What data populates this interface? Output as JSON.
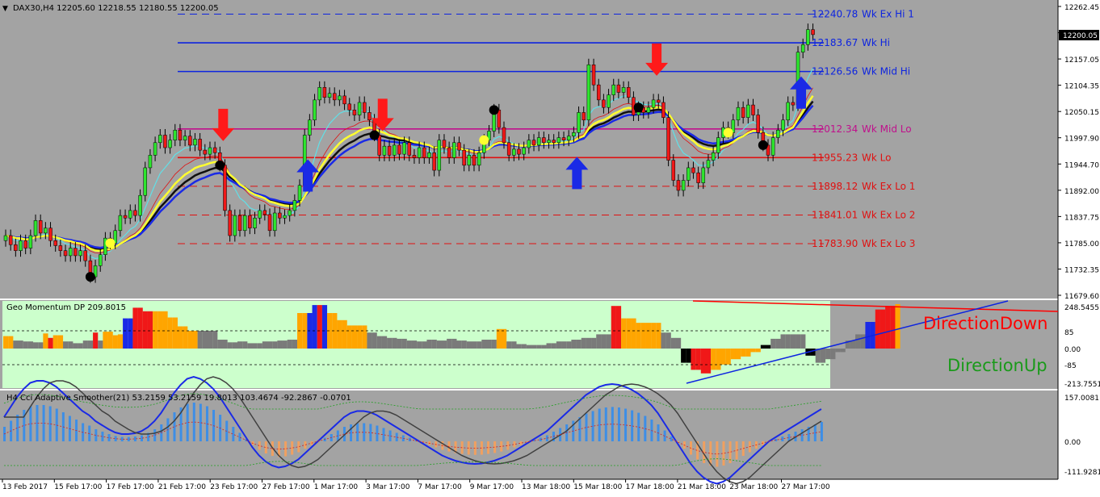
{
  "window": {
    "symbol_info": "DAX30,H4  12205.60 12218.55 12180.55 12200.05",
    "current_price_label": "12200.05"
  },
  "colors": {
    "background": "#a3a3a3",
    "bull_candle": "#2ee62e",
    "bear_candle": "#f01818",
    "resistance_line": "#0d24e0",
    "support_line": "#e01010",
    "mid_lo_line": "#c0108c",
    "ma_yellow": "#ffff30",
    "ma_blue": "#1a2ae6",
    "ma_black": "#101010",
    "ma_cyan": "#60e0e8",
    "momentum_bg": "#ccffcc",
    "hist_orange": "#ffa500",
    "hist_gray": "#7a7a7a",
    "cci_bar": "#3d8ee6",
    "cci_bar_neg": "#f0a060"
  },
  "time_axis": [
    "13 Feb 2017",
    "15 Feb 17:00",
    "17 Feb 17:00",
    "21 Feb 17:00",
    "23 Feb 17:00",
    "27 Feb 17:00",
    "1 Mar 17:00",
    "3 Mar 17:00",
    "7 Mar 17:00",
    "9 Mar 17:00",
    "13 Mar 18:00",
    "15 Mar 18:00",
    "17 Mar 18:00",
    "21 Mar 18:00",
    "23 Mar 18:00",
    "27 Mar 17:00"
  ],
  "main_price_axis": [
    "12262.45",
    "12208.75",
    "12157.05",
    "12104.35",
    "12050.15",
    "11997.90",
    "11944.70",
    "11892.00",
    "11837.75",
    "11785.00",
    "11732.35",
    "11679.60"
  ],
  "momentum_axis": [
    "248.5455",
    "85",
    "0.00",
    "-85",
    "-213.7551"
  ],
  "cci_axis": [
    "157.0081",
    "0.00",
    "-111.9281"
  ],
  "levels": [
    {
      "name": "Wk Ex Hi 1",
      "value": "12240.78",
      "text": "Wk Ex Hi 1",
      "color": "#0d24e0",
      "style": "dashed"
    },
    {
      "name": "Wk Hi",
      "value": "12183.67",
      "text": "Wk Hi",
      "color": "#0d24e0",
      "style": "solid"
    },
    {
      "name": "Wk Mid Hi",
      "value": "12126.56",
      "text": "Wk Mid Hi",
      "color": "#0d24e0",
      "style": "solid"
    },
    {
      "name": "Wk Mid Lo",
      "value": "12012.34",
      "text": "Wk Mid Lo",
      "color": "#c0108c",
      "style": "solid"
    },
    {
      "name": "Wk Lo",
      "value": "11955.23",
      "text": "Wk Lo",
      "color": "#e01010",
      "style": "solid"
    },
    {
      "name": "Wk Ex Lo 1",
      "value": "11898.12",
      "text": "Wk Ex Lo 1",
      "color": "#e01010",
      "style": "dashed"
    },
    {
      "name": "Wk Ex Lo 2",
      "value": "11841.01",
      "text": "Wk Ex Lo 2",
      "color": "#e01010",
      "style": "dashed"
    },
    {
      "name": "Wk Ex Lo 3",
      "value": "11783.90",
      "text": "Wk Ex Lo 3",
      "color": "#e01010",
      "style": "dashed"
    }
  ],
  "momentum": {
    "title": "Geo Momentum DP  209.8015",
    "direction_down": "DirectionDown",
    "direction_up": "DirectionUp"
  },
  "cci": {
    "title": "H4 Cci Adaptive Smoother(21) 53.2159 53.2159 19.8013 103.4674 -92.2867 -0.0701"
  },
  "chart_data": {
    "type": "candlestick",
    "y_range": [
      11679.6,
      12262.45
    ],
    "levels": [
      12240.78,
      12183.67,
      12126.56,
      12012.34,
      11955.23,
      11898.12,
      11841.01,
      11783.9
    ],
    "sell_arrows_at_candle": [
      43,
      75,
      130
    ],
    "buy_arrows_at_candle": [
      60,
      114,
      159
    ],
    "candles": [
      {
        "o": 11790,
        "c": 11800
      },
      {
        "o": 11800,
        "c": 11782
      },
      {
        "o": 11782,
        "c": 11770
      },
      {
        "o": 11770,
        "c": 11790
      },
      {
        "o": 11790,
        "c": 11775
      },
      {
        "o": 11775,
        "c": 11800
      },
      {
        "o": 11800,
        "c": 11830
      },
      {
        "o": 11830,
        "c": 11805
      },
      {
        "o": 11805,
        "c": 11815
      },
      {
        "o": 11815,
        "c": 11790
      },
      {
        "o": 11790,
        "c": 11780
      },
      {
        "o": 11780,
        "c": 11770
      },
      {
        "o": 11770,
        "c": 11760
      },
      {
        "o": 11760,
        "c": 11775
      },
      {
        "o": 11775,
        "c": 11760
      },
      {
        "o": 11760,
        "c": 11770
      },
      {
        "o": 11770,
        "c": 11750
      },
      {
        "o": 11750,
        "c": 11718
      },
      {
        "o": 11718,
        "c": 11740
      },
      {
        "o": 11740,
        "c": 11762
      },
      {
        "o": 11762,
        "c": 11795
      },
      {
        "o": 11795,
        "c": 11785
      },
      {
        "o": 11785,
        "c": 11810
      },
      {
        "o": 11810,
        "c": 11840
      },
      {
        "o": 11840,
        "c": 11835
      },
      {
        "o": 11835,
        "c": 11850
      },
      {
        "o": 11850,
        "c": 11840
      },
      {
        "o": 11840,
        "c": 11880
      },
      {
        "o": 11880,
        "c": 11935
      },
      {
        "o": 11935,
        "c": 11960
      },
      {
        "o": 11960,
        "c": 11985
      },
      {
        "o": 11985,
        "c": 12000
      },
      {
        "o": 12000,
        "c": 11975
      },
      {
        "o": 11975,
        "c": 11990
      },
      {
        "o": 11990,
        "c": 12010
      },
      {
        "o": 12010,
        "c": 11990
      },
      {
        "o": 11990,
        "c": 11998
      },
      {
        "o": 11998,
        "c": 11980
      },
      {
        "o": 11980,
        "c": 11992
      },
      {
        "o": 11992,
        "c": 11970
      },
      {
        "o": 11970,
        "c": 11962
      },
      {
        "o": 11962,
        "c": 11975
      },
      {
        "o": 11975,
        "c": 11965
      },
      {
        "o": 11965,
        "c": 11940
      },
      {
        "o": 11940,
        "c": 11850
      },
      {
        "o": 11850,
        "c": 11800
      },
      {
        "o": 11800,
        "c": 11840
      },
      {
        "o": 11840,
        "c": 11810
      },
      {
        "o": 11810,
        "c": 11840
      },
      {
        "o": 11840,
        "c": 11815
      },
      {
        "o": 11815,
        "c": 11835
      },
      {
        "o": 11835,
        "c": 11850
      },
      {
        "o": 11850,
        "c": 11842
      },
      {
        "o": 11842,
        "c": 11810
      },
      {
        "o": 11810,
        "c": 11845
      },
      {
        "o": 11845,
        "c": 11835
      },
      {
        "o": 11835,
        "c": 11840
      },
      {
        "o": 11840,
        "c": 11850
      },
      {
        "o": 11850,
        "c": 11870
      },
      {
        "o": 11870,
        "c": 11900
      },
      {
        "o": 11900,
        "c": 12000
      },
      {
        "o": 12000,
        "c": 12030
      },
      {
        "o": 12030,
        "c": 12070
      },
      {
        "o": 12070,
        "c": 12095
      },
      {
        "o": 12095,
        "c": 12075
      },
      {
        "o": 12075,
        "c": 12083
      },
      {
        "o": 12083,
        "c": 12070
      },
      {
        "o": 12070,
        "c": 12078
      },
      {
        "o": 12078,
        "c": 12062
      },
      {
        "o": 12062,
        "c": 12050
      },
      {
        "o": 12050,
        "c": 12040
      },
      {
        "o": 12040,
        "c": 12065
      },
      {
        "o": 12065,
        "c": 12045
      },
      {
        "o": 12045,
        "c": 12030
      },
      {
        "o": 12030,
        "c": 12000
      },
      {
        "o": 12000,
        "c": 11960
      },
      {
        "o": 11960,
        "c": 11978
      },
      {
        "o": 11978,
        "c": 11960
      },
      {
        "o": 11960,
        "c": 11980
      },
      {
        "o": 11980,
        "c": 11962
      },
      {
        "o": 11962,
        "c": 11985
      },
      {
        "o": 11985,
        "c": 11960
      },
      {
        "o": 11960,
        "c": 11955
      },
      {
        "o": 11955,
        "c": 11975
      },
      {
        "o": 11975,
        "c": 11955
      },
      {
        "o": 11955,
        "c": 11965
      },
      {
        "o": 11965,
        "c": 11930
      },
      {
        "o": 11930,
        "c": 11990
      },
      {
        "o": 11990,
        "c": 11975
      },
      {
        "o": 11975,
        "c": 11955
      },
      {
        "o": 11955,
        "c": 11985
      },
      {
        "o": 11985,
        "c": 11970
      },
      {
        "o": 11970,
        "c": 11940
      },
      {
        "o": 11940,
        "c": 11960
      },
      {
        "o": 11960,
        "c": 11940
      },
      {
        "o": 11940,
        "c": 11965
      },
      {
        "o": 11965,
        "c": 11990
      },
      {
        "o": 11990,
        "c": 12008
      },
      {
        "o": 12008,
        "c": 12050
      },
      {
        "o": 12050,
        "c": 12015
      },
      {
        "o": 12015,
        "c": 11985
      },
      {
        "o": 11985,
        "c": 11960
      },
      {
        "o": 11960,
        "c": 11972
      },
      {
        "o": 11972,
        "c": 11962
      },
      {
        "o": 11962,
        "c": 11975
      },
      {
        "o": 11975,
        "c": 11990
      },
      {
        "o": 11990,
        "c": 11980
      },
      {
        "o": 11980,
        "c": 11995
      },
      {
        "o": 11995,
        "c": 11985
      },
      {
        "o": 11985,
        "c": 11990
      },
      {
        "o": 11990,
        "c": 11985
      },
      {
        "o": 11985,
        "c": 11995
      },
      {
        "o": 11995,
        "c": 11990
      },
      {
        "o": 11990,
        "c": 11998
      },
      {
        "o": 11998,
        "c": 12005
      },
      {
        "o": 12005,
        "c": 12045
      },
      {
        "o": 12045,
        "c": 12030
      },
      {
        "o": 12030,
        "c": 12140
      },
      {
        "o": 12140,
        "c": 12100
      },
      {
        "o": 12100,
        "c": 12070
      },
      {
        "o": 12070,
        "c": 12055
      },
      {
        "o": 12055,
        "c": 12080
      },
      {
        "o": 12080,
        "c": 12100
      },
      {
        "o": 12100,
        "c": 12085
      },
      {
        "o": 12085,
        "c": 12095
      },
      {
        "o": 12095,
        "c": 12075
      },
      {
        "o": 12075,
        "c": 12040
      },
      {
        "o": 12040,
        "c": 12055
      },
      {
        "o": 12055,
        "c": 12045
      },
      {
        "o": 12045,
        "c": 12055
      },
      {
        "o": 12055,
        "c": 12070
      },
      {
        "o": 12070,
        "c": 12065
      },
      {
        "o": 12065,
        "c": 12035
      },
      {
        "o": 12035,
        "c": 11950
      },
      {
        "o": 11950,
        "c": 11910
      },
      {
        "o": 11910,
        "c": 11890
      },
      {
        "o": 11890,
        "c": 11910
      },
      {
        "o": 11910,
        "c": 11935
      },
      {
        "o": 11935,
        "c": 11925
      },
      {
        "o": 11925,
        "c": 11905
      },
      {
        "o": 11905,
        "c": 11935
      },
      {
        "o": 11935,
        "c": 11950
      },
      {
        "o": 11950,
        "c": 11965
      },
      {
        "o": 11965,
        "c": 11995
      },
      {
        "o": 11995,
        "c": 12015
      },
      {
        "o": 12015,
        "c": 12005
      },
      {
        "o": 12005,
        "c": 12030
      },
      {
        "o": 12030,
        "c": 12055
      },
      {
        "o": 12055,
        "c": 12035
      },
      {
        "o": 12035,
        "c": 12060
      },
      {
        "o": 12060,
        "c": 12040
      },
      {
        "o": 12040,
        "c": 12005
      },
      {
        "o": 12005,
        "c": 11980
      },
      {
        "o": 11980,
        "c": 11960
      },
      {
        "o": 11960,
        "c": 11995
      },
      {
        "o": 11995,
        "c": 12010
      },
      {
        "o": 12010,
        "c": 12030
      },
      {
        "o": 12030,
        "c": 12065
      },
      {
        "o": 12065,
        "c": 12060
      },
      {
        "o": 12060,
        "c": 12165
      },
      {
        "o": 12165,
        "c": 12180
      },
      {
        "o": 12180,
        "c": 12210
      },
      {
        "o": 12210,
        "c": 12200
      }
    ],
    "momentum_values": [
      70,
      70,
      45,
      45,
      40,
      40,
      35,
      35,
      85,
      60,
      75,
      75,
      40,
      40,
      30,
      30,
      45,
      45,
      90,
      45,
      95,
      95,
      75,
      80,
      170,
      170,
      230,
      230,
      210,
      210,
      210,
      210,
      210,
      175,
      175,
      125,
      125,
      100,
      100,
      100,
      100,
      100,
      100,
      50,
      50,
      35,
      35,
      40,
      40,
      30,
      30,
      30,
      40,
      40,
      40,
      45,
      45,
      50,
      50,
      200,
      200,
      200,
      245,
      245,
      245,
      200,
      200,
      160,
      160,
      130,
      130,
      130,
      130,
      90,
      90,
      70,
      70,
      60,
      60,
      55,
      55,
      45,
      45,
      40,
      40,
      50,
      50,
      45,
      45,
      55,
      55,
      45,
      45,
      40,
      40,
      40,
      50,
      50,
      50,
      110,
      110,
      40,
      40,
      25,
      25,
      20,
      20,
      20,
      20,
      30,
      30,
      40,
      40,
      40,
      50,
      50,
      60,
      60,
      60,
      80,
      80,
      80,
      240,
      240,
      170,
      170,
      170,
      145,
      145,
      145,
      145,
      145,
      90,
      90,
      60,
      60,
      -80,
      -80,
      -120,
      -120,
      -140,
      -140,
      -120,
      -120,
      -90,
      -90,
      -60,
      -60,
      -45,
      -45,
      -20,
      -20,
      20,
      20,
      55,
      55,
      80,
      80,
      80,
      80,
      80,
      -40,
      -40,
      -80,
      -80,
      -60,
      -60,
      -20,
      -20,
      45,
      45,
      80,
      80,
      150,
      150,
      220,
      220,
      240,
      240,
      250
    ],
    "momentum_colors": [
      "O",
      "O",
      "G",
      "G",
      "G",
      "G",
      "G",
      "G",
      "O",
      "R",
      "O",
      "O",
      "G",
      "G",
      "G",
      "G",
      "G",
      "G",
      "R",
      "G",
      "O",
      "O",
      "O",
      "O",
      "B",
      "B",
      "R",
      "R",
      "R",
      "R",
      "O",
      "O",
      "O",
      "O",
      "O",
      "O",
      "O",
      "O",
      "O",
      "G",
      "G",
      "G",
      "G",
      "G",
      "G",
      "G",
      "G",
      "G",
      "G",
      "G",
      "G",
      "G",
      "G",
      "G",
      "G",
      "G",
      "G",
      "G",
      "G",
      "O",
      "O",
      "B",
      "B",
      "R",
      "B",
      "O",
      "O",
      "O",
      "O",
      "O",
      "O",
      "O",
      "O",
      "G",
      "G",
      "G",
      "G",
      "G",
      "G",
      "G",
      "G",
      "G",
      "G",
      "G",
      "G",
      "G",
      "G",
      "G",
      "G",
      "G",
      "G",
      "G",
      "G",
      "G",
      "G",
      "G",
      "G",
      "G",
      "G",
      "O",
      "O",
      "G",
      "G",
      "G",
      "G",
      "G",
      "G",
      "G",
      "G",
      "G",
      "G",
      "G",
      "G",
      "G",
      "G",
      "G",
      "G",
      "G",
      "G",
      "G",
      "G",
      "G",
      "R",
      "R",
      "O",
      "O",
      "O",
      "O",
      "O",
      "O",
      "O",
      "O",
      "G",
      "G",
      "G",
      "G",
      "K",
      "K",
      "R",
      "R",
      "R",
      "R",
      "O",
      "O",
      "O",
      "O",
      "O",
      "O",
      "O",
      "O",
      "O",
      "O",
      "K",
      "K",
      "G",
      "G",
      "G",
      "G",
      "G",
      "G",
      "G",
      "K",
      "K",
      "G",
      "G",
      "G",
      "G",
      "G",
      "G",
      "G",
      "G",
      "G",
      "G",
      "B",
      "B",
      "R",
      "R",
      "R",
      "R",
      "O"
    ],
    "momentum_range": [
      -213.7551,
      248.5455
    ],
    "cci_values": [
      60,
      85,
      110,
      130,
      145,
      150,
      150,
      145,
      135,
      120,
      105,
      90,
      75,
      65,
      50,
      40,
      30,
      22,
      18,
      18,
      20,
      25,
      35,
      50,
      70,
      95,
      120,
      140,
      155,
      160,
      155,
      145,
      130,
      110,
      85,
      60,
      35,
      10,
      -15,
      -35,
      -50,
      -60,
      -65,
      -62,
      -55,
      -45,
      -30,
      -15,
      0,
      15,
      30,
      45,
      60,
      70,
      75,
      75,
      72,
      65,
      55,
      45,
      35,
      25,
      15,
      5,
      -5,
      -15,
      -25,
      -35,
      -42,
      -48,
      -52,
      -55,
      -56,
      -55,
      -52,
      -48,
      -42,
      -35,
      -25,
      -15,
      -5,
      5,
      15,
      25,
      40,
      55,
      70,
      85,
      100,
      115,
      125,
      135,
      140,
      142,
      140,
      135,
      128,
      118,
      105,
      90,
      70,
      45,
      20,
      -5,
      -30,
      -55,
      -75,
      -90,
      -100,
      -105,
      -100,
      -90,
      -75,
      -60,
      -45,
      -30,
      -15,
      0,
      10,
      20,
      30,
      40,
      50,
      60,
      70,
      80
    ],
    "cci_range": [
      -111.9281,
      157.0081
    ]
  }
}
